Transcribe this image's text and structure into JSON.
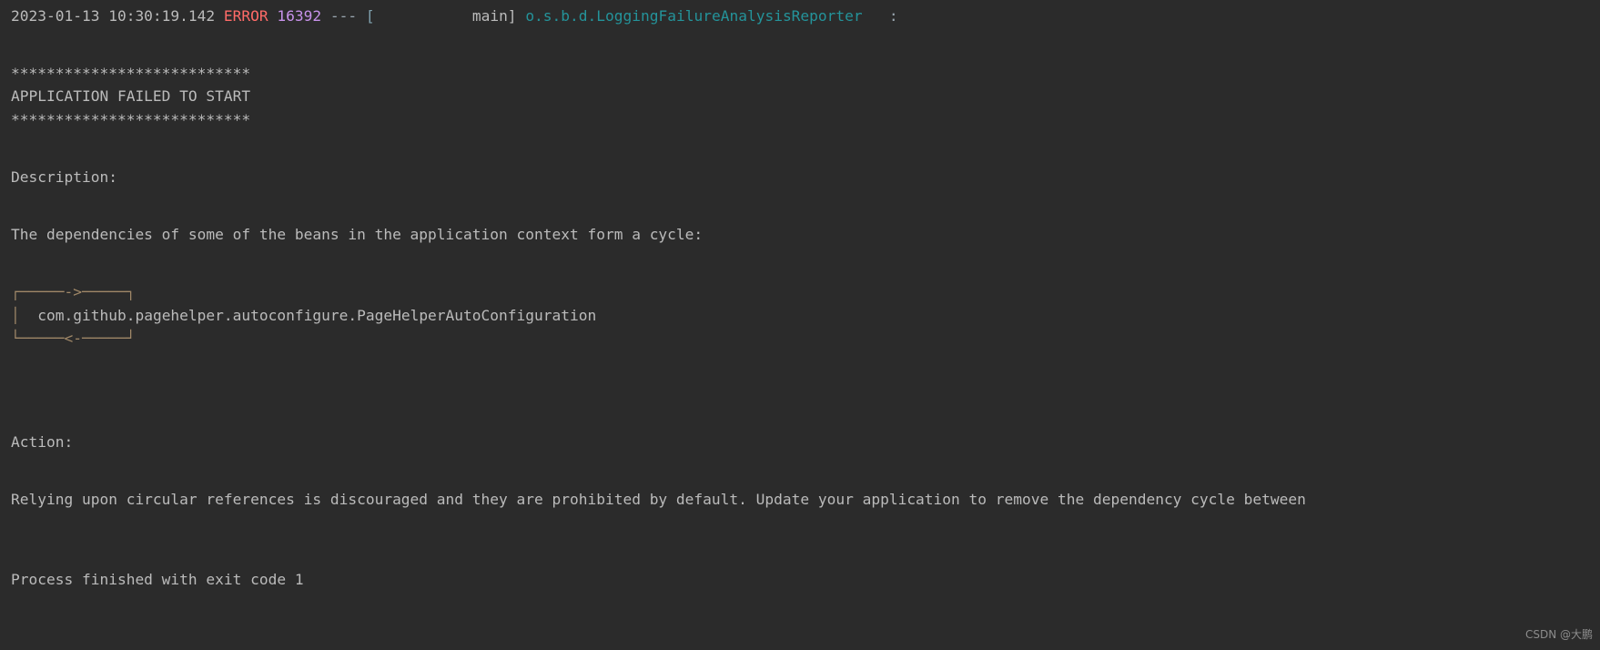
{
  "terminal": {
    "background_color": "#2b2b2b",
    "default_text_color": "#bbbbbb"
  },
  "log_header": {
    "timestamp": "2023-01-13 10:30:19.142",
    "level": "ERROR",
    "level_color": "#ff6b68",
    "pid": "16392",
    "pid_color": "#c792ea",
    "separator": "---",
    "bracket_open": "[",
    "thread": "           main]",
    "logger": "o.s.b.d.LoggingFailureAnalysisReporter",
    "logger_color": "#24939a",
    "message_colon": ":"
  },
  "banner": {
    "rule_top": "***************************",
    "title": "APPLICATION FAILED TO START",
    "rule_bottom": "***************************"
  },
  "description": {
    "heading": "Description:",
    "body": "The dependencies of some of the beans in the application context form a cycle:"
  },
  "cycle_diagram": {
    "top": "┌─────->─────┐",
    "middle_prefix": "│  ",
    "bean": "com.github.pagehelper.autoconfigure.PageHelperAutoConfiguration",
    "bottom": "└─────<-─────┘",
    "line_color": "#a08868"
  },
  "action": {
    "heading": "Action:",
    "body": "Relying upon circular references is discouraged and they are prohibited by default. Update your application to remove the dependency cycle between"
  },
  "process": {
    "exit_message": "Process finished with exit code 1"
  },
  "watermark": {
    "text": "CSDN @大鹏"
  }
}
